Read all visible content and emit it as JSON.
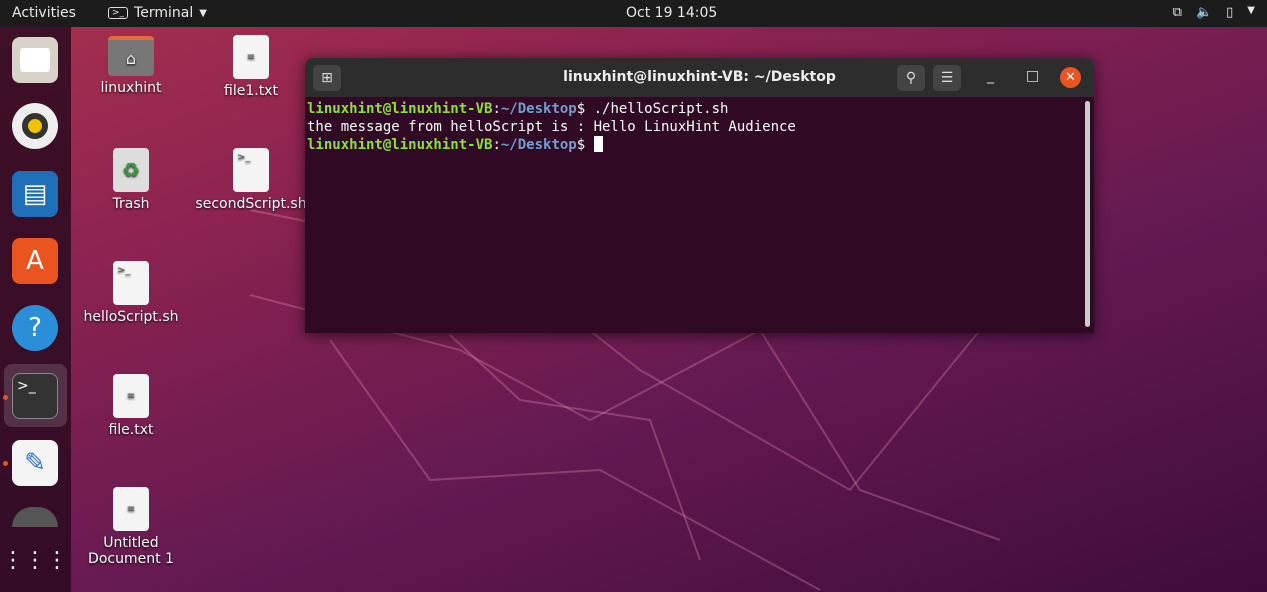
{
  "topbar": {
    "activities": "Activities",
    "app_name": "Terminal",
    "clock": "Oct 19  14:05"
  },
  "dock": {
    "items": [
      "Files",
      "Rhythmbox",
      "LibreOffice Writer",
      "Ubuntu Software",
      "Help",
      "Terminal",
      "Text Editor",
      "Show Applications"
    ]
  },
  "desktop": {
    "icons": [
      "linuxhint",
      "file1.txt",
      "Trash",
      "secondScript.sh",
      "helloScript.sh",
      "file.txt",
      "Untitled Document 1"
    ]
  },
  "terminal": {
    "title": "linuxhint@linuxhint-VB: ~/Desktop",
    "user_host": "linuxhint@linuxhint-VB",
    "path": "~/Desktop",
    "command": "./helloScript.sh",
    "output": "the message from helloScript is : Hello LinuxHint Audience"
  },
  "colors": {
    "accent": "#e95420",
    "prompt_user": "#8ae234",
    "prompt_path": "#729fcf",
    "terminal_bg": "#300a24"
  }
}
